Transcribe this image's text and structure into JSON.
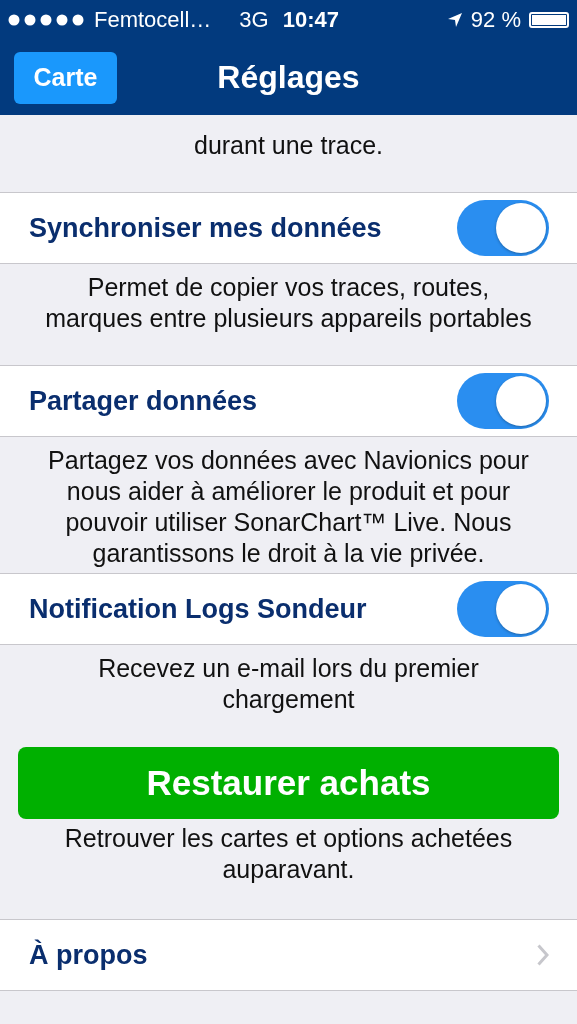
{
  "status_bar": {
    "carrier": "Femtocell…",
    "network": "3G",
    "time": "10:47",
    "battery": "92 %"
  },
  "nav": {
    "back_button": "Carte",
    "title": "Réglages"
  },
  "items": [
    {
      "kind": "description",
      "lines": [
        "durant une trace."
      ]
    },
    {
      "kind": "toggle",
      "label": "Synchroniser mes données",
      "on": true
    },
    {
      "kind": "description",
      "lines": [
        "Permet de copier vos traces, routes,",
        "marques entre plusieurs appareils portables"
      ]
    },
    {
      "kind": "toggle",
      "label": "Partager données",
      "on": true
    },
    {
      "kind": "description",
      "lines": [
        "Partagez vos données avec Navionics pour",
        "nous aider à améliorer le produit et pour",
        "pouvoir utiliser SonarChart™ Live. Nous",
        "garantissons le droit à la vie privée."
      ]
    },
    {
      "kind": "toggle",
      "label": "Notification Logs Sondeur",
      "on": true
    },
    {
      "kind": "description",
      "lines": [
        "Recevez un e-mail lors du premier",
        "chargement"
      ]
    },
    {
      "kind": "button",
      "label": "Restaurer achats"
    },
    {
      "kind": "description",
      "lines": [
        "Retrouver les cartes et options achetées",
        "auparavant."
      ]
    },
    {
      "kind": "link",
      "label": "À propos"
    }
  ]
}
